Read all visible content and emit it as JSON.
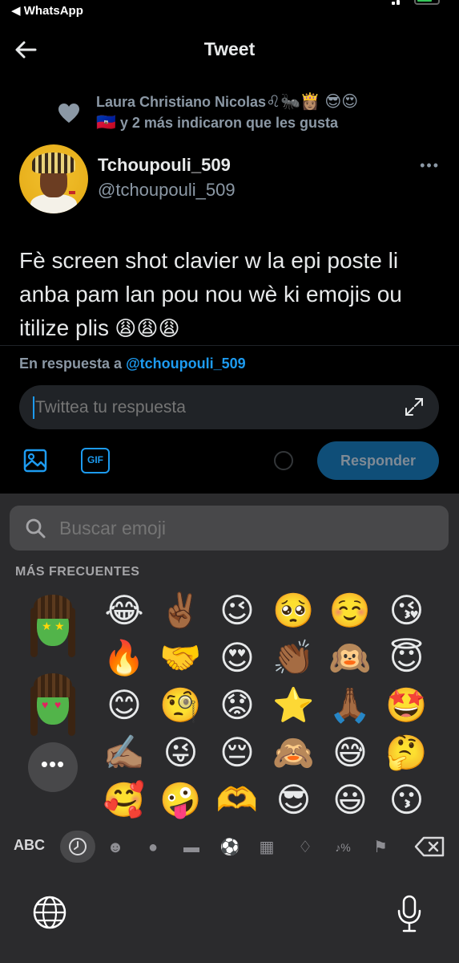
{
  "status_bar": {
    "back_label": "◀ WhatsApp"
  },
  "nav": {
    "title": "Tweet"
  },
  "likes": {
    "line1": "Laura Christiano Nicolas",
    "line1_emojis": "♌🐜👸🏽 😎😍",
    "line2_flag": "🇭🇹",
    "line2": " y 2 más indicaron que les gusta"
  },
  "tweet": {
    "display_name": "Tchoupouli_509",
    "handle": "@tchoupouli_509",
    "text": "Fè screen shot clavier w la epi poste li anba pam lan pou nou wè ki emojis ou itilize plis",
    "text_emojis": " 😩😩😩"
  },
  "reply": {
    "prefix": "En respuesta a ",
    "mention": "@tchoupouli_509",
    "placeholder": "Twittea tu respuesta",
    "gif_label": "GIF",
    "respond_label": "Responder"
  },
  "keyboard": {
    "search_placeholder": "Buscar emoji",
    "section_label": "MÁS FRECUENTES",
    "more_label": "•••",
    "abc_label": "ABC",
    "emojis": [
      "😂",
      "✌🏾",
      "😉",
      "🥺",
      "☺️",
      "😘",
      "🔥",
      "🤝",
      "😍",
      "👏🏾",
      "🙉",
      "😇",
      "😊",
      "🧐",
      "😟",
      "⭐",
      "🙏🏾",
      "🤩",
      "✍🏽",
      "😜",
      "😔",
      "🙈",
      "😅",
      "🤔",
      "🥰",
      "🤪",
      "🫶",
      "😎",
      "😃",
      "😗"
    ],
    "categories": [
      "recent-icon",
      "smiley-icon",
      "animal-icon",
      "food-icon",
      "activity-icon",
      "travel-icon",
      "objects-icon",
      "symbols-icon",
      "flags-icon"
    ]
  }
}
